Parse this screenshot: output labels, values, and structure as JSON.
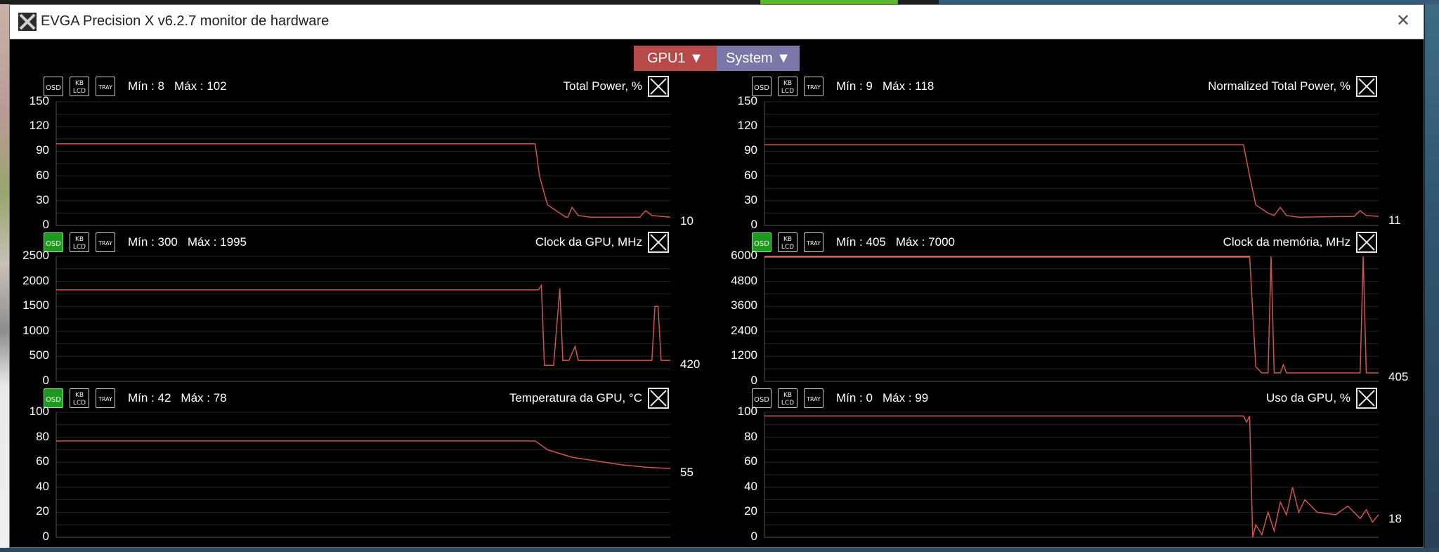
{
  "window": {
    "title": "EVGA Precision X v6.2.7 monitor de hardware"
  },
  "selectors": {
    "gpu_label": "GPU1 ▼",
    "system_label": "System ▼"
  },
  "buttons": {
    "osd": "OSD",
    "kb_top": "KB",
    "kb_bottom": "LCD",
    "tray": "TRAY"
  },
  "colors": {
    "trace": "#d05353",
    "trace_yellow": "#e7e24a",
    "grid": "#262626",
    "osd_active": "#1d9a1d",
    "gpu_selector": "#b84a4a",
    "system_selector": "#7a78a8"
  },
  "panels": [
    {
      "title": "Total Power, %",
      "min": "Mín : 8",
      "max": "Máx : 102",
      "current": "10",
      "osd_active": false,
      "ticks": [
        "150",
        "120",
        "90",
        "60",
        "30",
        "0"
      ],
      "chart_data": {
        "type": "line",
        "ylim": [
          0,
          150
        ],
        "points": [
          [
            0,
            99
          ],
          [
            0.78,
            99
          ],
          [
            0.787,
            60
          ],
          [
            0.8,
            25
          ],
          [
            0.82,
            15
          ],
          [
            0.83,
            10
          ],
          [
            0.833,
            10
          ],
          [
            0.84,
            22
          ],
          [
            0.85,
            12
          ],
          [
            0.87,
            10
          ],
          [
            0.95,
            10
          ],
          [
            0.96,
            18
          ],
          [
            0.97,
            12
          ],
          [
            1,
            10
          ]
        ]
      }
    },
    {
      "title": "Normalized Total Power, %",
      "min": "Mín : 9",
      "max": "Máx : 118",
      "current": "11",
      "osd_active": false,
      "ticks": [
        "150",
        "120",
        "90",
        "60",
        "30",
        "0"
      ],
      "chart_data": {
        "type": "line",
        "ylim": [
          0,
          150
        ],
        "points": [
          [
            0,
            98
          ],
          [
            0.78,
            98
          ],
          [
            0.79,
            60
          ],
          [
            0.8,
            25
          ],
          [
            0.82,
            15
          ],
          [
            0.83,
            12
          ],
          [
            0.84,
            22
          ],
          [
            0.85,
            12
          ],
          [
            0.87,
            10
          ],
          [
            0.96,
            11
          ],
          [
            0.97,
            18
          ],
          [
            0.98,
            12
          ],
          [
            1,
            11
          ]
        ]
      }
    },
    {
      "title": "Clock da GPU, MHz",
      "min": "Mín : 300",
      "max": "Máx : 1995",
      "current": "420",
      "osd_active": true,
      "ticks": [
        "2500",
        "2000",
        "1500",
        "1000",
        "500",
        "0"
      ],
      "chart_data": {
        "type": "line",
        "ylim": [
          0,
          2500
        ],
        "points": [
          [
            0,
            1830
          ],
          [
            0.785,
            1830
          ],
          [
            0.79,
            1920
          ],
          [
            0.795,
            320
          ],
          [
            0.81,
            320
          ],
          [
            0.82,
            1860
          ],
          [
            0.825,
            420
          ],
          [
            0.835,
            420
          ],
          [
            0.845,
            700
          ],
          [
            0.85,
            420
          ],
          [
            0.97,
            420
          ],
          [
            0.975,
            1500
          ],
          [
            0.98,
            1500
          ],
          [
            0.985,
            420
          ],
          [
            1,
            420
          ]
        ]
      }
    },
    {
      "title": "Clock da memória, MHz",
      "min": "Mín : 405",
      "max": "Máx : 7000",
      "current": "405",
      "osd_active": true,
      "ticks": [
        "6000",
        "4800",
        "3600",
        "2400",
        "1200",
        "0"
      ],
      "chart_data": {
        "type": "line",
        "ylim": [
          0,
          6000
        ],
        "highlight": "yellow",
        "points": [
          [
            0,
            6000
          ],
          [
            0.79,
            6000
          ],
          [
            0.8,
            700
          ],
          [
            0.81,
            405
          ],
          [
            0.82,
            405
          ],
          [
            0.825,
            6000
          ],
          [
            0.83,
            405
          ],
          [
            0.84,
            405
          ],
          [
            0.845,
            800
          ],
          [
            0.85,
            405
          ],
          [
            0.97,
            405
          ],
          [
            0.975,
            6000
          ],
          [
            0.98,
            405
          ],
          [
            1,
            405
          ]
        ]
      }
    },
    {
      "title": "Temperatura da GPU, °C",
      "min": "Mín : 42",
      "max": "Máx : 78",
      "current": "55",
      "osd_active": true,
      "ticks": [
        "100",
        "80",
        "60",
        "40",
        "20",
        "0"
      ],
      "chart_data": {
        "type": "line",
        "ylim": [
          0,
          100
        ],
        "points": [
          [
            0,
            77
          ],
          [
            0.78,
            77
          ],
          [
            0.8,
            70
          ],
          [
            0.84,
            64
          ],
          [
            0.88,
            61
          ],
          [
            0.92,
            58
          ],
          [
            0.96,
            56
          ],
          [
            1,
            55
          ]
        ]
      }
    },
    {
      "title": "Uso da GPU, %",
      "min": "Mín : 0",
      "max": "Máx : 99",
      "current": "18",
      "osd_active": false,
      "ticks": [
        "100",
        "80",
        "60",
        "40",
        "20",
        "0"
      ],
      "chart_data": {
        "type": "line",
        "ylim": [
          0,
          100
        ],
        "points": [
          [
            0,
            97
          ],
          [
            0.78,
            97
          ],
          [
            0.785,
            92
          ],
          [
            0.79,
            97
          ],
          [
            0.795,
            0
          ],
          [
            0.8,
            10
          ],
          [
            0.81,
            2
          ],
          [
            0.82,
            20
          ],
          [
            0.83,
            5
          ],
          [
            0.84,
            28
          ],
          [
            0.85,
            18
          ],
          [
            0.86,
            40
          ],
          [
            0.87,
            20
          ],
          [
            0.88,
            30
          ],
          [
            0.9,
            20
          ],
          [
            0.93,
            18
          ],
          [
            0.95,
            25
          ],
          [
            0.97,
            15
          ],
          [
            0.98,
            22
          ],
          [
            0.99,
            12
          ],
          [
            1,
            18
          ]
        ]
      }
    }
  ]
}
